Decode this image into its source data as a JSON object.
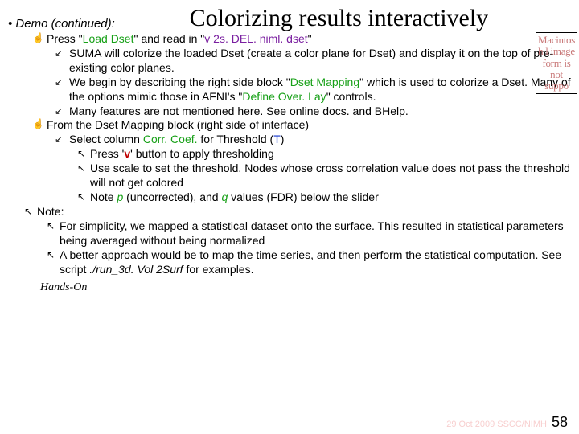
{
  "header": {
    "demo_label": "• Demo (continued):",
    "title": "Colorizing results interactively"
  },
  "lines": {
    "l1a": "Press \"",
    "l1b": "Load Dset",
    "l1c": "\" and read in \"",
    "l1d": "v 2s. DEL. niml. dset",
    "l1e": "\"",
    "l2": "SUMA will colorize the loaded Dset (create a color plane for Dset) and display it on the top of pre-existing color planes.",
    "l3a": "We begin by describing the right side block \"",
    "l3b": "Dset Mapping",
    "l3c": "\" which is used to colorize a Dset. Many of the options mimic those in AFNI's \"",
    "l3d": "Define Over. Lay",
    "l3e": "\" controls.",
    "l4": "Many features are not mentioned here. See online docs. and BHelp.",
    "l5": "From the Dset Mapping block (right side of interface)",
    "l6a": "Select column ",
    "l6b": "Corr. Coef.",
    "l6c": " for Threshold (",
    "l6d": "T",
    "l6e": ")",
    "l7a": "Press '",
    "l7b": "v",
    "l7c": "' button to apply thresholding",
    "l8": "Use scale to set the threshold. Nodes whose cross correlation value does not pass the threshold will not get colored",
    "l9a": "Note ",
    "l9b": "p",
    "l9c": " (uncorrected), and ",
    "l9d": "q",
    "l9e": " values (FDR) below the slider",
    "note": "Note:",
    "n1": "For simplicity, we mapped a statistical dataset onto the surface. This resulted in statistical parameters being averaged without being normalized",
    "n2a": "A better approach would be to map the time series, and then perform the statistical computation. See script ",
    "n2b": "./run_3d. Vol 2Surf",
    "n2c": " for examples."
  },
  "hands_on": "Hands-On",
  "footer_date": "29 Oct 2009 SSCC/NIMH",
  "page_number": "58",
  "missing_img": "Macintosh l image form is not suppo"
}
